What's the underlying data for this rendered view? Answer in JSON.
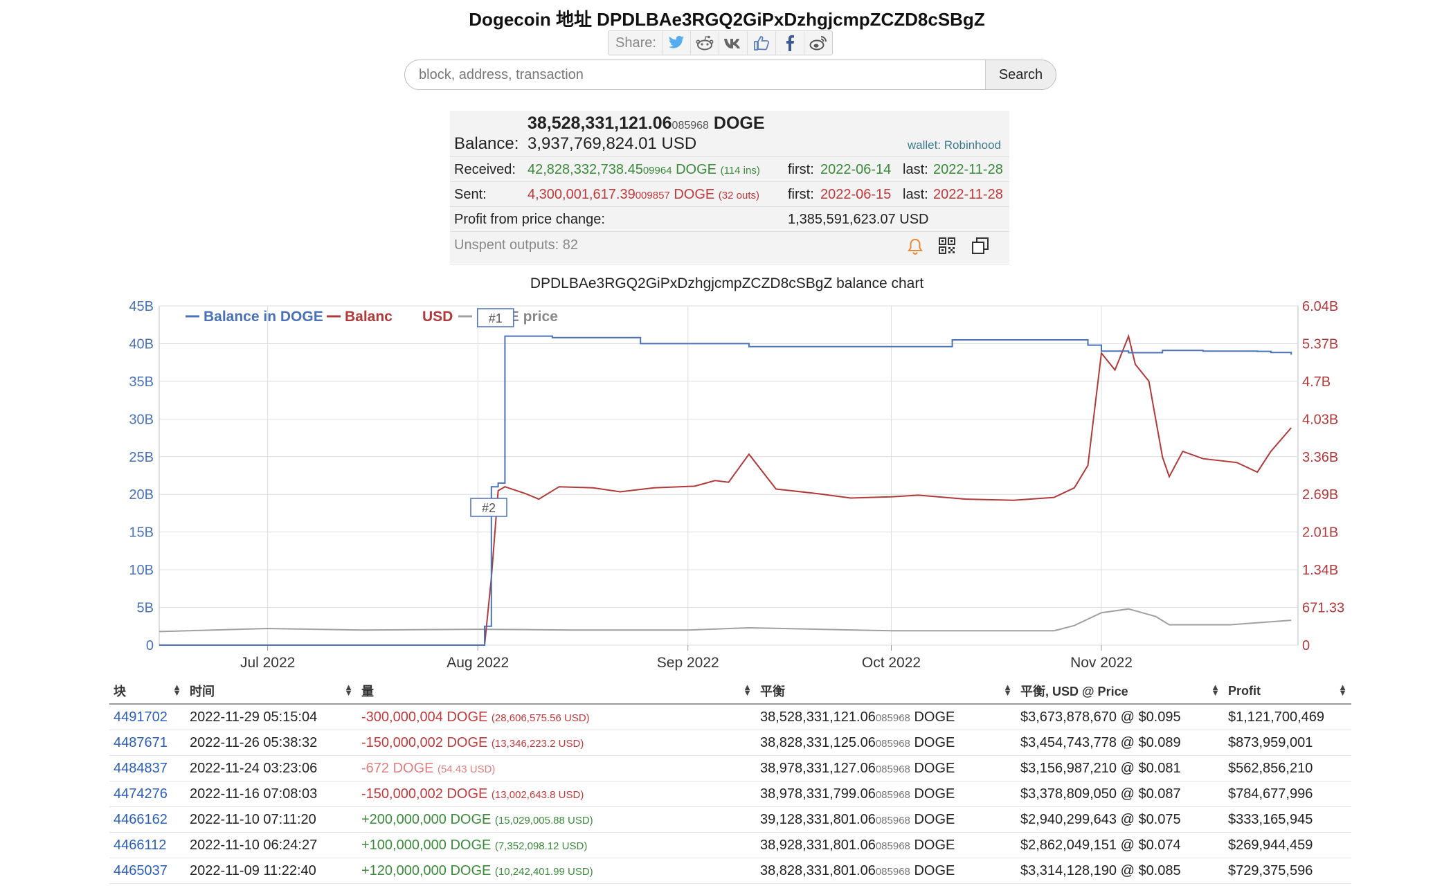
{
  "header": {
    "title": "Dogecoin 地址 DPDLBAe3RGQ2GiPxDzhgjcmpZCZD8cSBgZ",
    "share_label": "Share:",
    "share_icons": [
      "twitter-icon",
      "reddit-icon",
      "vk-icon",
      "like-icon",
      "facebook-icon",
      "weibo-icon"
    ]
  },
  "search": {
    "placeholder": "block, address, transaction",
    "button": "Search"
  },
  "summary": {
    "balance_doge_main": "38,528,331,121.06",
    "balance_doge_frac": "085968",
    "balance_doge_unit": "DOGE",
    "balance_label": "Balance:",
    "balance_usd": "3,937,769,824.01 USD",
    "wallet": "wallet: Robinhood",
    "received_label": "Received:",
    "received_main": "42,828,332,738.45",
    "received_frac": "09964",
    "received_unit": "DOGE",
    "received_ins": "(114 ins)",
    "received_first_label": "first:",
    "received_first": "2022-06-14",
    "received_last_label": "last:",
    "received_last": "2022-11-28",
    "sent_label": "Sent:",
    "sent_main": "4,300,001,617.39",
    "sent_frac": "009857",
    "sent_unit": "DOGE",
    "sent_outs": "(32 outs)",
    "sent_first_label": "first:",
    "sent_first": "2022-06-15",
    "sent_last_label": "last:",
    "sent_last": "2022-11-28",
    "profit_label": "Profit from price change:",
    "profit_value": "1,385,591,623.07 USD",
    "unspent_label": "Unspent outputs: 82",
    "action_icons": [
      "bell-icon",
      "qr-code-icon",
      "copy-icon"
    ]
  },
  "chart_title": "DPDLBAe3RGQ2GiPxDzhgjcmpZCZD8cSBgZ balance chart",
  "chart_data": {
    "type": "line",
    "legend": {
      "position": "top-left",
      "entries": [
        "Balance in DOGE",
        "Balance in USD",
        "DOGE price"
      ]
    },
    "legend_visible_texts": [
      "Balance in DOGE",
      "Balanc",
      "USD",
      "DOGE price"
    ],
    "colors": {
      "doge": "#4a72b8",
      "usd": "#b03a3a",
      "price": "#a0a0a0"
    },
    "x_ticks": [
      "Jul 2022",
      "Aug 2022",
      "Sep 2022",
      "Oct 2022",
      "Nov 2022"
    ],
    "x_tick_dates": [
      "2022-07-01",
      "2022-08-01",
      "2022-09-01",
      "2022-10-01",
      "2022-11-01"
    ],
    "x_range": [
      "2022-06-15",
      "2022-11-30"
    ],
    "y_left_ticks": [
      "0",
      "5B",
      "10B",
      "15B",
      "20B",
      "25B",
      "30B",
      "35B",
      "40B",
      "45B"
    ],
    "y_left_range": [
      0,
      45
    ],
    "y_left_unit": "B",
    "y_right_ticks": [
      "0",
      "671.33",
      "1.34B",
      "2.01B",
      "2.69B",
      "3.36B",
      "4.03B",
      "4.7B",
      "5.37B",
      "6.04B"
    ],
    "grid": true,
    "annotations": [
      {
        "label": "#1",
        "date": "2022-08-03"
      },
      {
        "label": "#2",
        "date": "2022-08-02"
      }
    ],
    "series": [
      {
        "name": "Balance in DOGE",
        "axis": "left",
        "points": [
          [
            "2022-06-15",
            0
          ],
          [
            "2022-08-02",
            0
          ],
          [
            "2022-08-02",
            2.5
          ],
          [
            "2022-08-03",
            21
          ],
          [
            "2022-08-04",
            21.5
          ],
          [
            "2022-08-05",
            30.5
          ],
          [
            "2022-08-05",
            41
          ],
          [
            "2022-08-10",
            41
          ],
          [
            "2022-08-12",
            40.8
          ],
          [
            "2022-08-23",
            40.8
          ],
          [
            "2022-08-25",
            40
          ],
          [
            "2022-09-01",
            40
          ],
          [
            "2022-09-10",
            39.6
          ],
          [
            "2022-10-01",
            39.6
          ],
          [
            "2022-10-10",
            40.5
          ],
          [
            "2022-10-25",
            40.5
          ],
          [
            "2022-10-30",
            39.8
          ],
          [
            "2022-11-01",
            39
          ],
          [
            "2022-11-05",
            38.8
          ],
          [
            "2022-11-09",
            38.8
          ],
          [
            "2022-11-10",
            39.1
          ],
          [
            "2022-11-16",
            39
          ],
          [
            "2022-11-24",
            38.98
          ],
          [
            "2022-11-26",
            38.83
          ],
          [
            "2022-11-29",
            38.53
          ]
        ]
      },
      {
        "name": "Balance in USD",
        "axis": "right",
        "points": [
          [
            "2022-08-02",
            0
          ],
          [
            "2022-08-03",
            1.2
          ],
          [
            "2022-08-04",
            2.75
          ],
          [
            "2022-08-05",
            2.82
          ],
          [
            "2022-08-08",
            2.7
          ],
          [
            "2022-08-10",
            2.6
          ],
          [
            "2022-08-13",
            2.82
          ],
          [
            "2022-08-18",
            2.8
          ],
          [
            "2022-08-22",
            2.73
          ],
          [
            "2022-08-27",
            2.8
          ],
          [
            "2022-09-02",
            2.83
          ],
          [
            "2022-09-05",
            2.93
          ],
          [
            "2022-09-07",
            2.9
          ],
          [
            "2022-09-10",
            3.4
          ],
          [
            "2022-09-14",
            2.78
          ],
          [
            "2022-09-20",
            2.7
          ],
          [
            "2022-09-25",
            2.62
          ],
          [
            "2022-10-01",
            2.64
          ],
          [
            "2022-10-05",
            2.67
          ],
          [
            "2022-10-12",
            2.6
          ],
          [
            "2022-10-19",
            2.58
          ],
          [
            "2022-10-25",
            2.63
          ],
          [
            "2022-10-28",
            2.8
          ],
          [
            "2022-10-30",
            3.2
          ],
          [
            "2022-11-01",
            5.2
          ],
          [
            "2022-11-03",
            4.9
          ],
          [
            "2022-11-05",
            5.5
          ],
          [
            "2022-11-06",
            5.0
          ],
          [
            "2022-11-08",
            4.7
          ],
          [
            "2022-11-10",
            3.35
          ],
          [
            "2022-11-11",
            3.0
          ],
          [
            "2022-11-13",
            3.45
          ],
          [
            "2022-11-16",
            3.32
          ],
          [
            "2022-11-21",
            3.25
          ],
          [
            "2022-11-24",
            3.08
          ],
          [
            "2022-11-26",
            3.45
          ],
          [
            "2022-11-29",
            3.87
          ]
        ]
      },
      {
        "name": "DOGE price",
        "axis": "left",
        "points": [
          [
            "2022-06-15",
            1.8
          ],
          [
            "2022-07-01",
            2.2
          ],
          [
            "2022-07-15",
            2.0
          ],
          [
            "2022-08-01",
            2.1
          ],
          [
            "2022-08-15",
            2.0
          ],
          [
            "2022-09-01",
            2.0
          ],
          [
            "2022-09-10",
            2.3
          ],
          [
            "2022-10-01",
            1.9
          ],
          [
            "2022-10-25",
            1.9
          ],
          [
            "2022-10-28",
            2.6
          ],
          [
            "2022-11-01",
            4.3
          ],
          [
            "2022-11-05",
            4.8
          ],
          [
            "2022-11-09",
            3.8
          ],
          [
            "2022-11-11",
            2.7
          ],
          [
            "2022-11-20",
            2.7
          ],
          [
            "2022-11-29",
            3.3
          ]
        ]
      }
    ]
  },
  "table": {
    "columns": [
      "块",
      "时间",
      "量",
      "平衡",
      "平衡, USD @ Price",
      "Profit"
    ],
    "rows": [
      {
        "block": "4491702",
        "time": "2022-11-29 05:15:04",
        "amount": "-300,000,004 DOGE",
        "amount_usd": "(28,606,575.56 USD)",
        "sign": "neg",
        "bal_main": "38,528,331,121.06",
        "bal_frac": "085968",
        "bal_unit": "DOGE",
        "usd_price": "$3,673,878,670 @ $0.095",
        "profit": "$1,121,700,469"
      },
      {
        "block": "4487671",
        "time": "2022-11-26 05:38:32",
        "amount": "-150,000,002 DOGE",
        "amount_usd": "(13,346,223.2 USD)",
        "sign": "neg",
        "bal_main": "38,828,331,125.06",
        "bal_frac": "085968",
        "bal_unit": "DOGE",
        "usd_price": "$3,454,743,778 @ $0.089",
        "profit": "$873,959,001"
      },
      {
        "block": "4484837",
        "time": "2022-11-24 03:23:06",
        "amount": "-672 DOGE",
        "amount_usd": "(54.43 USD)",
        "sign": "negsmall",
        "bal_main": "38,978,331,127.06",
        "bal_frac": "085968",
        "bal_unit": "DOGE",
        "usd_price": "$3,156,987,210 @ $0.081",
        "profit": "$562,856,210"
      },
      {
        "block": "4474276",
        "time": "2022-11-16 07:08:03",
        "amount": "-150,000,002 DOGE",
        "amount_usd": "(13,002,643.8 USD)",
        "sign": "neg",
        "bal_main": "38,978,331,799.06",
        "bal_frac": "085968",
        "bal_unit": "DOGE",
        "usd_price": "$3,378,809,050 @ $0.087",
        "profit": "$784,677,996"
      },
      {
        "block": "4466162",
        "time": "2022-11-10 07:11:20",
        "amount": "+200,000,000 DOGE",
        "amount_usd": "(15,029,005.88 USD)",
        "sign": "pos",
        "bal_main": "39,128,331,801.06",
        "bal_frac": "085968",
        "bal_unit": "DOGE",
        "usd_price": "$2,940,299,643 @ $0.075",
        "profit": "$333,165,945"
      },
      {
        "block": "4466112",
        "time": "2022-11-10 06:24:27",
        "amount": "+100,000,000 DOGE",
        "amount_usd": "(7,352,098.12 USD)",
        "sign": "pos",
        "bal_main": "38,928,331,801.06",
        "bal_frac": "085968",
        "bal_unit": "DOGE",
        "usd_price": "$2,862,049,151 @ $0.074",
        "profit": "$269,944,459"
      },
      {
        "block": "4465037",
        "time": "2022-11-09 11:22:40",
        "amount": "+120,000,000 DOGE",
        "amount_usd": "(10,242,401.99 USD)",
        "sign": "pos",
        "bal_main": "38,828,331,801.06",
        "bal_frac": "085968",
        "bal_unit": "DOGE",
        "usd_price": "$3,314,128,190 @ $0.085",
        "profit": "$729,375,596"
      }
    ]
  }
}
